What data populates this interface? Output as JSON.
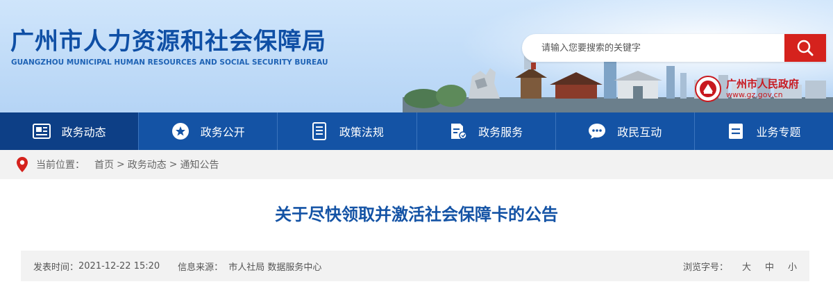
{
  "header": {
    "title": "广州市人力资源和社会保障局",
    "subtitle": "GUANGZHOU MUNICIPAL HUMAN RESOURCES AND SOCIAL SECURITY BUREAU",
    "search_placeholder": "请输入您要搜索的关键字",
    "search_icon": "search-icon",
    "gov_name": "广州市人民政府",
    "gov_url": "www.gz.gov.cn"
  },
  "nav": {
    "items": [
      {
        "label": "政务动态",
        "icon": "newspaper-icon"
      },
      {
        "label": "政务公开",
        "icon": "star-icon"
      },
      {
        "label": "政策法规",
        "icon": "document-icon"
      },
      {
        "label": "政务服务",
        "icon": "service-icon"
      },
      {
        "label": "政民互动",
        "icon": "chat-icon"
      },
      {
        "label": "业务专题",
        "icon": "list-icon"
      }
    ]
  },
  "breadcrumb": {
    "label": "当前位置：",
    "items": [
      "首页",
      "政务动态",
      "通知公告"
    ],
    "separator": ">"
  },
  "article": {
    "title": "关于尽快领取并激活社会保障卡的公告",
    "publish_label": "发表时间：",
    "publish_value": "2021-12-22 15:20",
    "source_label": "信息来源：",
    "source_value": "市人社局 数据服务中心",
    "font_label": "浏览字号：",
    "font_options": [
      "大",
      "中",
      "小"
    ]
  },
  "colors": {
    "brand_blue": "#1453a5",
    "search_red": "#d5221d",
    "gov_red": "#c8181e",
    "meta_bg": "#f2f2f2"
  }
}
